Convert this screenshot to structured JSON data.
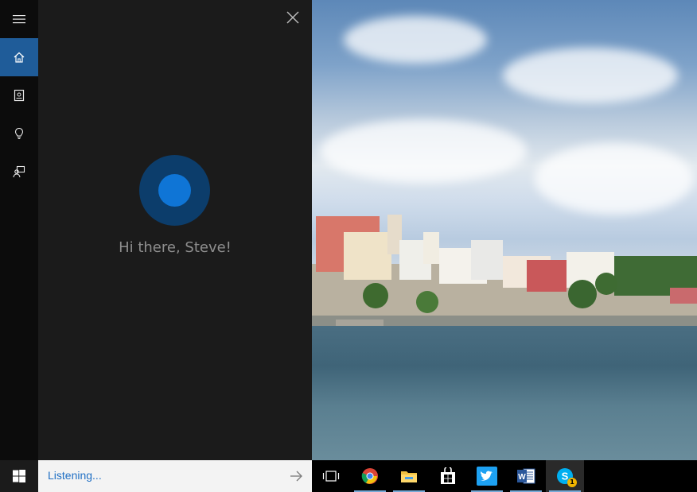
{
  "nav_rail": {
    "items": [
      {
        "name": "menu",
        "icon": "hamburger-icon"
      },
      {
        "name": "home",
        "icon": "home-icon",
        "active": true
      },
      {
        "name": "notebook",
        "icon": "notebook-icon"
      },
      {
        "name": "reminders",
        "icon": "lightbulb-icon"
      },
      {
        "name": "feedback",
        "icon": "feedback-icon"
      }
    ]
  },
  "cortana": {
    "greeting": "Hi there, Steve!",
    "accent_color": "#0f75d6"
  },
  "taskbar": {
    "search_text": "Listening...",
    "apps": [
      {
        "name": "task-view",
        "icon": "task-view-icon"
      },
      {
        "name": "chrome",
        "icon": "chrome-icon"
      },
      {
        "name": "file-explorer",
        "icon": "folder-icon"
      },
      {
        "name": "store",
        "icon": "store-icon"
      },
      {
        "name": "twitter",
        "icon": "twitter-icon"
      },
      {
        "name": "word",
        "icon": "word-icon"
      },
      {
        "name": "skype",
        "icon": "skype-icon",
        "badge": "1"
      }
    ]
  }
}
